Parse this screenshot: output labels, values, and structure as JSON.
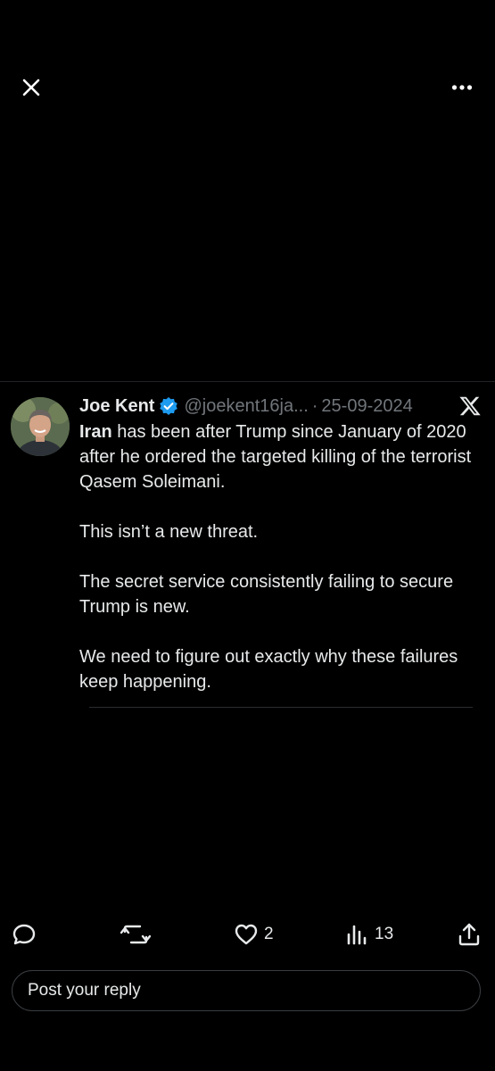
{
  "top_bar": {
    "close_icon": "close-icon",
    "more_icon": "more-horizontal-icon"
  },
  "tweet": {
    "author_name": "Joe Kent",
    "verified": true,
    "handle": "@joekent16ja...",
    "separator": "·",
    "date": "25-09-2024",
    "source_logo": "x-logo",
    "text_bold_lead": "Iran",
    "paragraph_1_rest": " has been after Trump since January of 2020 after he ordered the targeted killing of the terrorist Qasem Soleimani.",
    "paragraph_2": "This isn’t a new threat.",
    "paragraph_3": "The secret service consistently failing to secure Trump is new.",
    "paragraph_4": "We need to figure out exactly why these failures keep happening."
  },
  "actions": {
    "reply_icon": "reply-icon",
    "repost_icon": "repost-icon",
    "like_icon": "heart-icon",
    "like_count": "2",
    "views_icon": "views-icon",
    "views_count": "13",
    "share_icon": "share-icon"
  },
  "reply": {
    "placeholder": "Post your reply"
  },
  "colors": {
    "background": "#000000",
    "text": "#e7e9ea",
    "muted": "#71767b",
    "verified": "#1d9bf0"
  }
}
